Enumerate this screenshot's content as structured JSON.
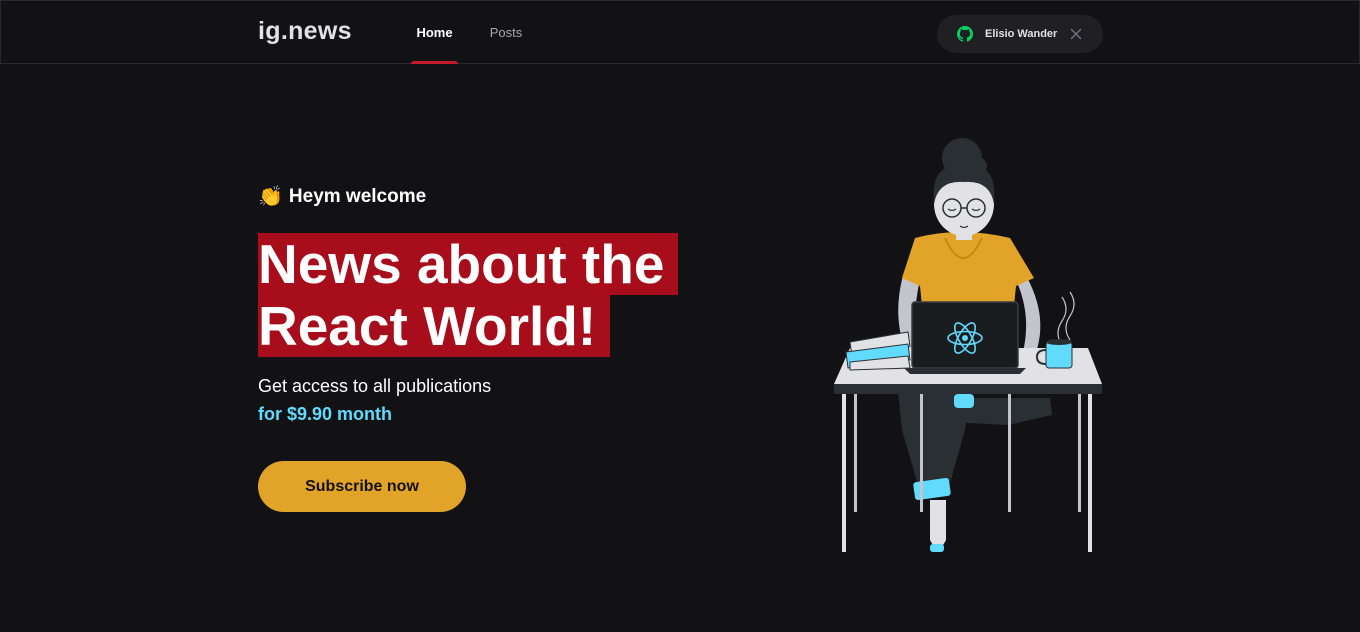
{
  "header": {
    "logo": "ig.news",
    "nav": [
      {
        "label": "Home",
        "active": true
      },
      {
        "label": "Posts",
        "active": false
      }
    ],
    "user": {
      "name": "Elisio Wander",
      "icon": "github-icon",
      "icon_color": "#04d361"
    }
  },
  "hero": {
    "welcome_emoji": "👏",
    "welcome": "Heym welcome",
    "headline_line1": "News about the",
    "headline_line2": "React World!",
    "access_text": "Get access to all publications",
    "price_text": "for $9.90 month",
    "subscribe_label": "Subscribe now"
  },
  "colors": {
    "background": "#121214",
    "accent_red": "#a70d1a",
    "accent_yellow": "#e2a428",
    "accent_cyan": "#61dafb",
    "text": "#e1e1e6"
  }
}
